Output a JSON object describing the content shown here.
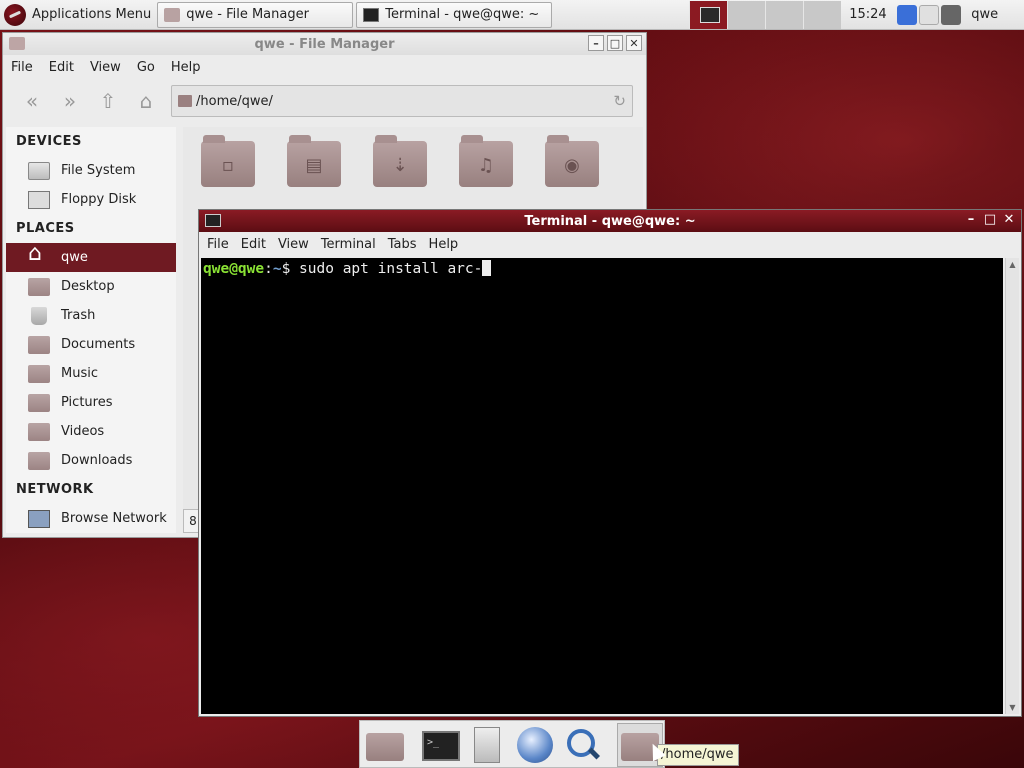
{
  "top_panel": {
    "app_menu_label": "Applications Menu",
    "tasks": [
      {
        "label": "qwe - File Manager"
      },
      {
        "label": "Terminal - qwe@qwe: ~"
      }
    ],
    "clock": "15:24",
    "user": "qwe"
  },
  "file_manager": {
    "title": "qwe - File Manager",
    "menu": [
      "File",
      "Edit",
      "View",
      "Go",
      "Help"
    ],
    "path": "/home/qwe/",
    "sections": {
      "devices": "DEVICES",
      "places": "PLACES",
      "network": "NETWORK"
    },
    "devices": [
      {
        "label": "File System",
        "icon": "drive-icon"
      },
      {
        "label": "Floppy Disk",
        "icon": "floppy-icon"
      }
    ],
    "places": [
      {
        "label": "qwe",
        "icon": "home-icon",
        "selected": true
      },
      {
        "label": "Desktop",
        "icon": "folder-icon"
      },
      {
        "label": "Trash",
        "icon": "trash-icon"
      },
      {
        "label": "Documents",
        "icon": "folder-icon"
      },
      {
        "label": "Music",
        "icon": "folder-icon"
      },
      {
        "label": "Pictures",
        "icon": "folder-icon"
      },
      {
        "label": "Videos",
        "icon": "folder-icon"
      },
      {
        "label": "Downloads",
        "icon": "folder-icon"
      }
    ],
    "network": [
      {
        "label": "Browse Network",
        "icon": "network-icon"
      }
    ],
    "status_fragment": "8"
  },
  "terminal": {
    "title": "Terminal - qwe@qwe: ~",
    "menu": [
      "File",
      "Edit",
      "View",
      "Terminal",
      "Tabs",
      "Help"
    ],
    "prompt_user": "qwe@qwe",
    "prompt_sep": ":",
    "prompt_path": "~",
    "prompt_symbol": "$",
    "command": "sudo apt install arc-"
  },
  "dock": {
    "tooltip": "/home/qwe"
  },
  "colors": {
    "accent": "#6f1a22",
    "terminal_title": "#7a141c",
    "prompt_user": "#8ae234",
    "prompt_path": "#729fcf"
  }
}
